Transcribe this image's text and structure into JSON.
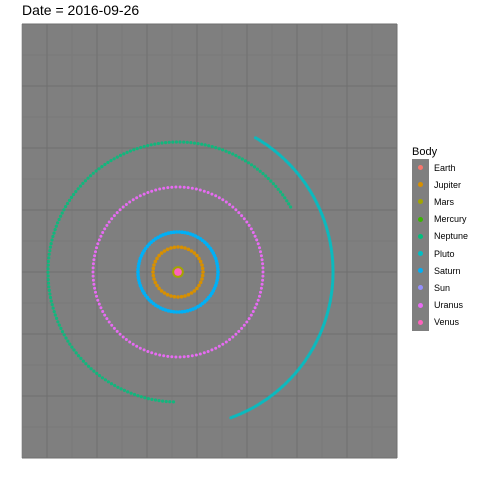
{
  "title": "Date = 2016-09-26",
  "colors": {
    "panel": "#7f7f7f",
    "grid_major": "#6f6f6f",
    "grid_minor": "#777777"
  },
  "chart_data": {
    "type": "scatter",
    "title": "Date = 2016-09-26",
    "xlabel": "",
    "ylabel": "",
    "grid": true,
    "legend": {
      "title": "Body",
      "position": "right"
    },
    "series": [
      {
        "name": "Earth",
        "color": "#F8766D",
        "orbit_radius": 3,
        "arc_from_deg": 0,
        "arc_to_deg": 360,
        "points": 30
      },
      {
        "name": "Jupiter",
        "color": "#D89000",
        "orbit_radius": 25,
        "arc_from_deg": 0,
        "arc_to_deg": 360,
        "points": 44
      },
      {
        "name": "Mars",
        "color": "#A3A500",
        "orbit_radius": 4,
        "arc_from_deg": 0,
        "arc_to_deg": 360,
        "points": 30
      },
      {
        "name": "Mercury",
        "color": "#39B600",
        "orbit_radius": 1.5,
        "arc_from_deg": 0,
        "arc_to_deg": 360,
        "points": 12
      },
      {
        "name": "Neptune",
        "color": "#00BF7D",
        "orbit_radius": 130,
        "arc_from_deg": 30,
        "arc_to_deg": 268,
        "points": 150
      },
      {
        "name": "Pluto",
        "color": "#00BFC4",
        "orbit_radius": 155,
        "arc_from_deg": 290,
        "arc_to_deg": 420,
        "points": 170
      },
      {
        "name": "Saturn",
        "color": "#00B0F6",
        "orbit_radius": 40,
        "arc_from_deg": 0,
        "arc_to_deg": 360,
        "points": 90
      },
      {
        "name": "Sun",
        "color": "#9590FF",
        "orbit_radius": 0,
        "arc_from_deg": 0,
        "arc_to_deg": 360,
        "points": 1
      },
      {
        "name": "Uranus",
        "color": "#E76BF3",
        "orbit_radius": 85,
        "arc_from_deg": 0,
        "arc_to_deg": 360,
        "points": 130
      },
      {
        "name": "Venus",
        "color": "#FF62BC",
        "orbit_radius": 2,
        "arc_from_deg": 0,
        "arc_to_deg": 360,
        "points": 14
      }
    ]
  }
}
